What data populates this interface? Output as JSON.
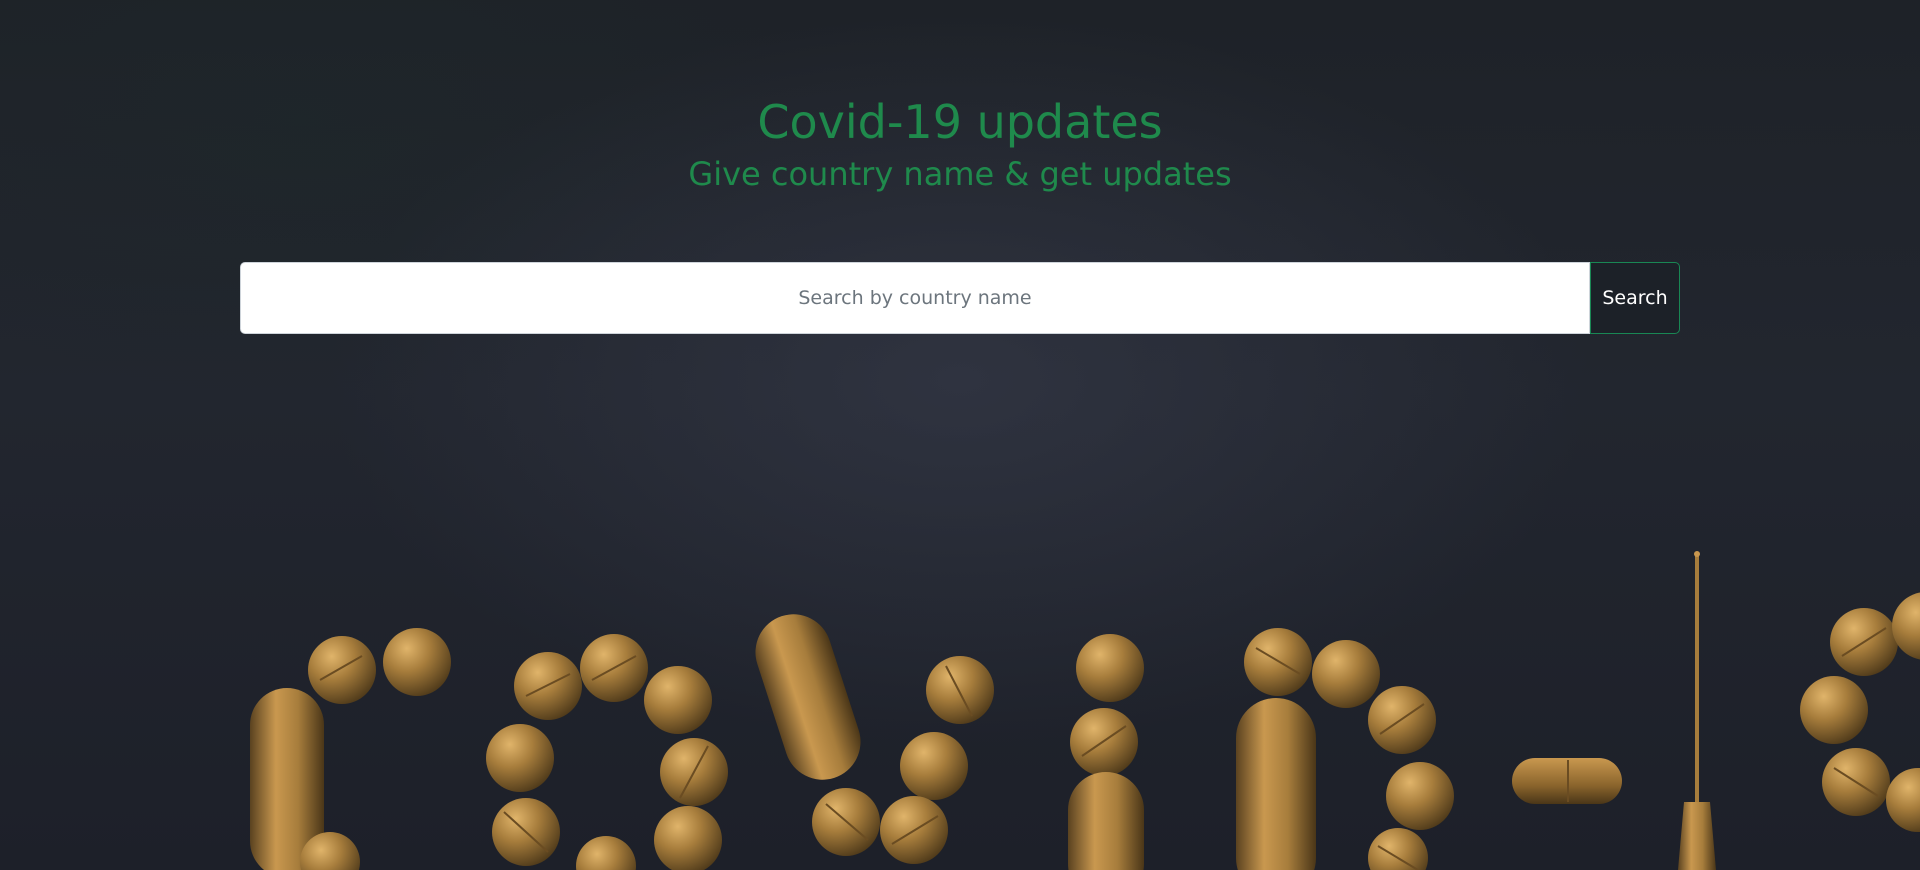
{
  "header": {
    "title": "Covid-19 updates",
    "subtitle": "Give country name & get updates"
  },
  "search": {
    "placeholder": "Search by country name",
    "value": "",
    "button_label": "Search"
  },
  "colors": {
    "accent": "#1f8a4c",
    "background": "#1c1f27",
    "button_border": "#198754",
    "pill_gold": "#a77d3c"
  },
  "background_image": {
    "subject": "gold pills spelling covid-19 with a syringe on dark background"
  }
}
